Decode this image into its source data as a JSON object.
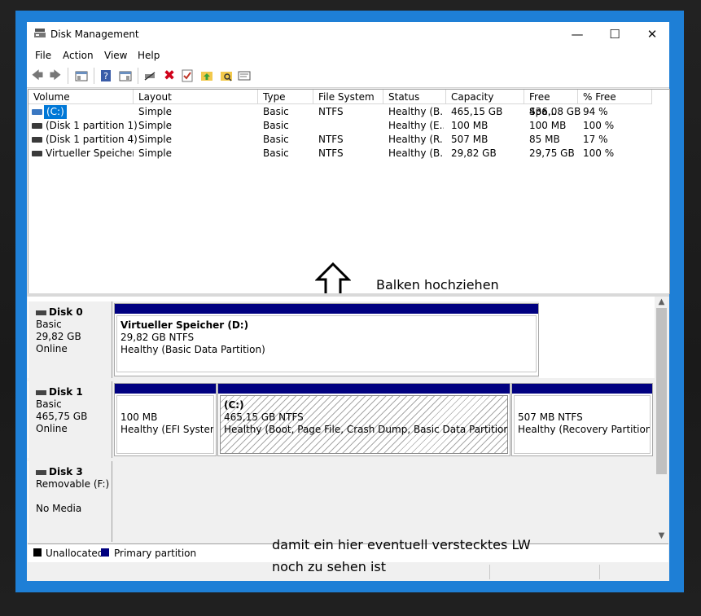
{
  "window": {
    "title": "Disk Management"
  },
  "menu": [
    "File",
    "Action",
    "View",
    "Help"
  ],
  "columns": [
    "Volume",
    "Layout",
    "Type",
    "File System",
    "Status",
    "Capacity",
    "Free Spa...",
    "% Free"
  ],
  "volumes": [
    {
      "volume": "(C:)",
      "layout": "Simple",
      "type": "Basic",
      "fs": "NTFS",
      "status": "Healthy (B...",
      "capacity": "465,15 GB",
      "free": "436,08 GB",
      "pct": "94 %"
    },
    {
      "volume": "(Disk 1 partition 1)",
      "layout": "Simple",
      "type": "Basic",
      "fs": "",
      "status": "Healthy (E...",
      "capacity": "100 MB",
      "free": "100 MB",
      "pct": "100 %"
    },
    {
      "volume": "(Disk 1 partition 4)",
      "layout": "Simple",
      "type": "Basic",
      "fs": "NTFS",
      "status": "Healthy (R...",
      "capacity": "507 MB",
      "free": "85 MB",
      "pct": "17 %"
    },
    {
      "volume": "Virtueller Speicher ...",
      "layout": "Simple",
      "type": "Basic",
      "fs": "NTFS",
      "status": "Healthy (B...",
      "capacity": "29,82 GB",
      "free": "29,75 GB",
      "pct": "100 %"
    }
  ],
  "disks": [
    {
      "name": "Disk 0",
      "type": "Basic",
      "size": "29,82 GB",
      "state": "Online",
      "partitions": [
        {
          "label": "Virtueller Speicher  (D:)",
          "size": "29,82 GB NTFS",
          "status": "Healthy (Basic Data Partition)"
        }
      ]
    },
    {
      "name": "Disk 1",
      "type": "Basic",
      "size": "465,75 GB",
      "state": "Online",
      "partitions": [
        {
          "label": "",
          "size": "100 MB",
          "status": "Healthy (EFI System P"
        },
        {
          "label": "(C:)",
          "size": "465,15 GB NTFS",
          "status": "Healthy (Boot, Page File, Crash Dump, Basic Data Partition)"
        },
        {
          "label": "",
          "size": "507 MB NTFS",
          "status": "Healthy (Recovery Partition)"
        }
      ]
    },
    {
      "name": "Disk 3",
      "type": "Removable (F:)",
      "size": "",
      "state": "No Media",
      "partitions": []
    }
  ],
  "legend": [
    "Unallocated",
    "Primary partition"
  ],
  "colors": {
    "primary_partition": "#000080",
    "unallocated": "#000000",
    "selection": "#0078d7",
    "frame": "#1e7fd6"
  },
  "annotations": {
    "pull_bar": "Balken hochziehen",
    "hidden_drive_line1": "damit ein hier eventuell verstecktes LW",
    "hidden_drive_line2": "noch zu sehen ist"
  }
}
